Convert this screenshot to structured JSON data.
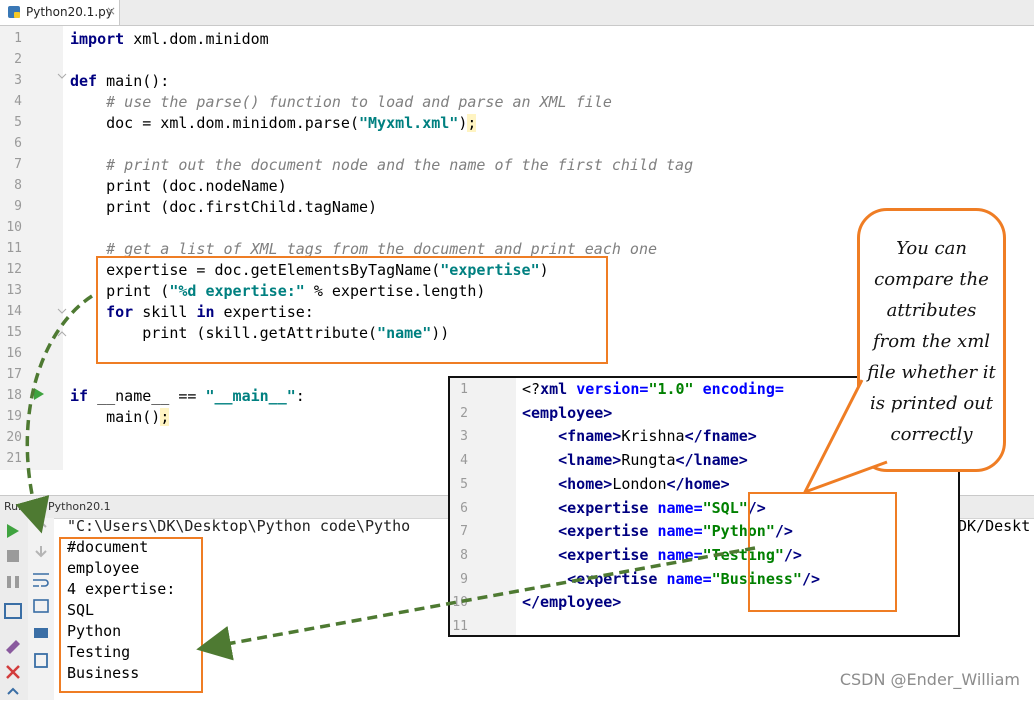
{
  "tab": {
    "title": "Python20.1.py",
    "close": "×"
  },
  "editor": {
    "line_numbers": [
      "1",
      "2",
      "3",
      "4",
      "5",
      "6",
      "7",
      "8",
      "9",
      "10",
      "11",
      "12",
      "13",
      "14",
      "15",
      "16",
      "17",
      "18",
      "19",
      "20",
      "21"
    ],
    "lines": [
      [
        {
          "t": "import",
          "c": "kw"
        },
        {
          "t": " xml.dom.minidom"
        }
      ],
      [],
      [
        {
          "t": "def",
          "c": "kw"
        },
        {
          "t": " main():"
        }
      ],
      [
        {
          "t": "    # use the parse() function to load and parse an XML file",
          "c": "cm"
        }
      ],
      [
        {
          "t": "    doc = xml.dom.minidom.parse("
        },
        {
          "t": "\"Myxml.xml\"",
          "c": "str"
        },
        {
          "t": ")"
        },
        {
          "t": ";",
          "c": "hl"
        }
      ],
      [],
      [
        {
          "t": "    # print out the document node and the name of the first child tag",
          "c": "cm"
        }
      ],
      [
        {
          "t": "    print (doc.nodeName)"
        }
      ],
      [
        {
          "t": "    print (doc.firstChild.tagName)"
        }
      ],
      [],
      [
        {
          "t": "    # get a list of XML tags from the document and print each one",
          "c": "cm"
        }
      ],
      [
        {
          "t": "    expertise = doc.getElementsByTagName("
        },
        {
          "t": "\"expertise\"",
          "c": "str"
        },
        {
          "t": ")"
        }
      ],
      [
        {
          "t": "    print ("
        },
        {
          "t": "\"%d expertise:\"",
          "c": "str"
        },
        {
          "t": " % expertise.length)"
        }
      ],
      [
        {
          "t": "    "
        },
        {
          "t": "for",
          "c": "kw"
        },
        {
          "t": " skill "
        },
        {
          "t": "in",
          "c": "kw"
        },
        {
          "t": " expertise:"
        }
      ],
      [
        {
          "t": "        print (skill.getAttribute("
        },
        {
          "t": "\"name\"",
          "c": "str"
        },
        {
          "t": "))"
        }
      ],
      [],
      [],
      [
        {
          "t": "if",
          "c": "kw"
        },
        {
          "t": " __name__ == "
        },
        {
          "t": "\"__main__\"",
          "c": "str"
        },
        {
          "t": ":"
        }
      ],
      [
        {
          "t": "    main()"
        },
        {
          "t": ";",
          "c": "hl"
        }
      ],
      [],
      []
    ]
  },
  "run": {
    "label": "Run",
    "config": "Python20.1",
    "command_left": "\"C:\\Users\\DK\\Desktop\\Python code\\Pytho",
    "command_right": "DK/Deskt",
    "output": [
      "#document",
      "employee",
      "4 expertise:",
      "SQL",
      "Python",
      "Testing",
      "Business"
    ]
  },
  "xml_panel": {
    "line_numbers": [
      "1",
      "2",
      "3",
      "4",
      "5",
      "6",
      "7",
      "8",
      "9",
      "10",
      "11"
    ],
    "lines": [
      [
        {
          "t": "<?",
          "c": "p"
        },
        {
          "t": "xml ",
          "c": "tag"
        },
        {
          "t": "version=",
          "c": "attr"
        },
        {
          "t": "\"1.0\" ",
          "c": "xs"
        },
        {
          "t": "encoding=",
          "c": "attr"
        }
      ],
      [
        {
          "t": "<employee>",
          "c": "tag"
        }
      ],
      [
        {
          "t": "    "
        },
        {
          "t": "<fname>",
          "c": "tag"
        },
        {
          "t": "Krishna"
        },
        {
          "t": "</fname>",
          "c": "tag"
        }
      ],
      [
        {
          "t": "    "
        },
        {
          "t": "<lname>",
          "c": "tag"
        },
        {
          "t": "Rungta"
        },
        {
          "t": "</lname>",
          "c": "tag"
        }
      ],
      [
        {
          "t": "    "
        },
        {
          "t": "<home>",
          "c": "tag"
        },
        {
          "t": "London"
        },
        {
          "t": "</home>",
          "c": "tag"
        }
      ],
      [
        {
          "t": "    "
        },
        {
          "t": "<expertise ",
          "c": "tag"
        },
        {
          "t": "name=",
          "c": "attr"
        },
        {
          "t": "\"SQL\"",
          "c": "xs"
        },
        {
          "t": "/>",
          "c": "tag"
        }
      ],
      [
        {
          "t": "    "
        },
        {
          "t": "<expertise ",
          "c": "tag"
        },
        {
          "t": "name=",
          "c": "attr"
        },
        {
          "t": "\"Python\"",
          "c": "xs"
        },
        {
          "t": "/>",
          "c": "tag"
        }
      ],
      [
        {
          "t": "    "
        },
        {
          "t": "<expertise ",
          "c": "tag"
        },
        {
          "t": "name=",
          "c": "attr"
        },
        {
          "t": "\"Testing\"",
          "c": "xs"
        },
        {
          "t": "/>",
          "c": "tag"
        }
      ],
      [
        {
          "t": "     "
        },
        {
          "t": "<expertise ",
          "c": "tag"
        },
        {
          "t": "name=",
          "c": "attr"
        },
        {
          "t": "\"Business\"",
          "c": "xs"
        },
        {
          "t": "/>",
          "c": "tag"
        }
      ],
      [
        {
          "t": "</employee>",
          "c": "tag"
        }
      ],
      []
    ]
  },
  "callout": {
    "text": "You can compare the attributes from the xml file whether it is printed out correctly"
  },
  "watermark": "CSDN @Ender_William",
  "colors": {
    "accent": "#ef7d24",
    "arrow": "#4e7a32",
    "keyword": "#000080",
    "string": "#008080",
    "comment": "#808080"
  }
}
